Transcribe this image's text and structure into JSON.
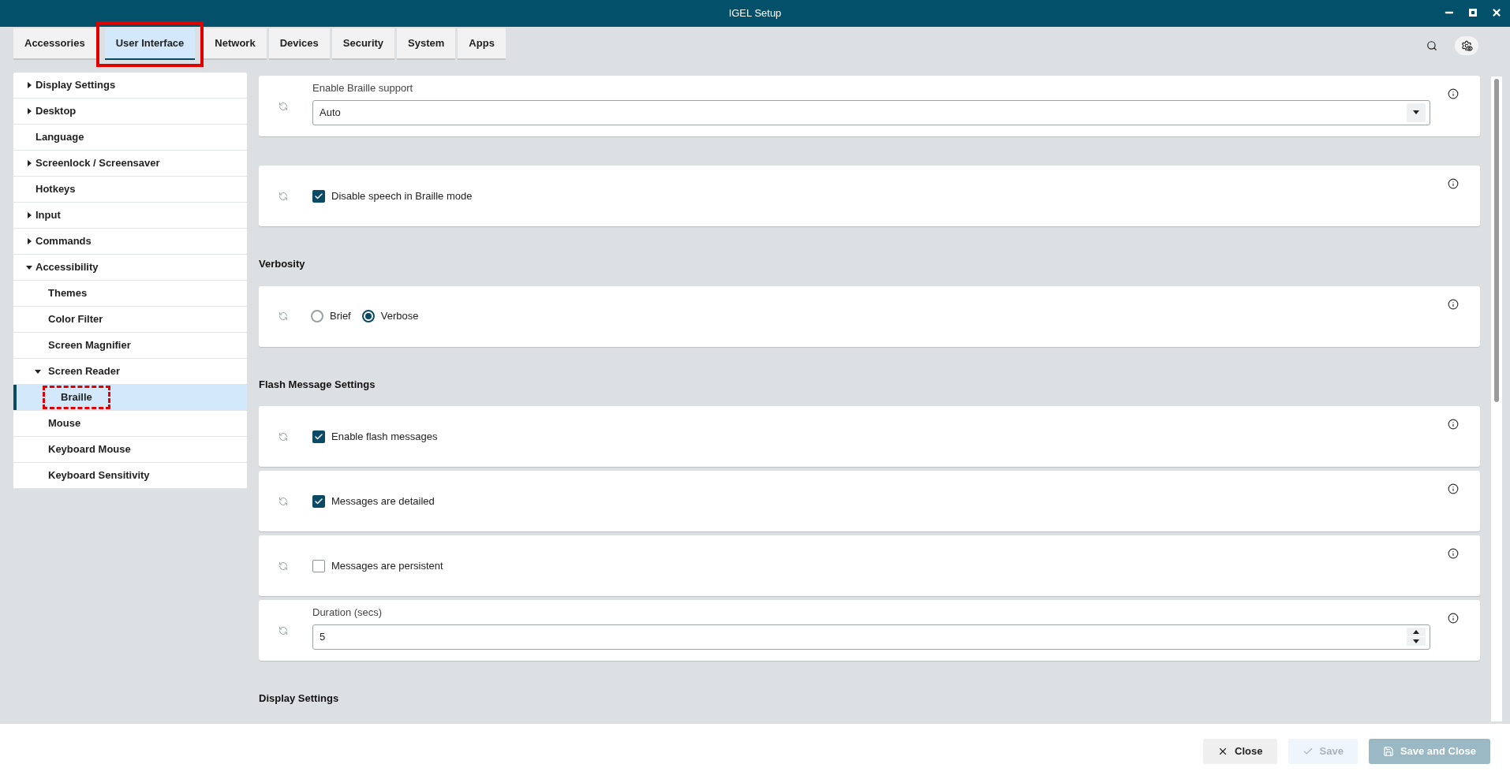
{
  "window": {
    "title": "IGEL Setup"
  },
  "tabs": [
    {
      "label": "Accessories",
      "selected": false,
      "highlighted": false
    },
    {
      "label": "User Interface",
      "selected": true,
      "highlighted": true
    },
    {
      "label": "Network",
      "selected": false,
      "highlighted": false
    },
    {
      "label": "Devices",
      "selected": false,
      "highlighted": false
    },
    {
      "label": "Security",
      "selected": false,
      "highlighted": false
    },
    {
      "label": "System",
      "selected": false,
      "highlighted": false
    },
    {
      "label": "Apps",
      "selected": false,
      "highlighted": false
    }
  ],
  "sidebar": {
    "items": [
      {
        "label": "Display Settings",
        "expanded": false,
        "selected": false
      },
      {
        "label": "Desktop",
        "expanded": false,
        "selected": false
      },
      {
        "label": "Language",
        "selected": false
      },
      {
        "label": "Screenlock / Screensaver",
        "expanded": false,
        "selected": false
      },
      {
        "label": "Hotkeys",
        "selected": false
      },
      {
        "label": "Input",
        "expanded": false,
        "selected": false
      },
      {
        "label": "Commands",
        "expanded": false,
        "selected": false
      },
      {
        "label": "Accessibility",
        "expanded": true,
        "selected": false,
        "children": [
          {
            "label": "Themes",
            "selected": false
          },
          {
            "label": "Color Filter",
            "selected": false
          },
          {
            "label": "Screen Magnifier",
            "selected": false
          },
          {
            "label": "Screen Reader",
            "expanded": true,
            "selected": false,
            "children": [
              {
                "label": "Braille",
                "selected": true,
                "highlighted": true
              }
            ]
          },
          {
            "label": "Mouse",
            "selected": false
          },
          {
            "label": "Keyboard Mouse",
            "selected": false
          },
          {
            "label": "Keyboard Sensitivity",
            "selected": false
          }
        ]
      }
    ]
  },
  "sections": [
    {
      "settings": [
        {
          "kind": "select",
          "label": "Enable Braille support",
          "value": "Auto"
        }
      ]
    },
    {
      "settings": [
        {
          "kind": "checkbox",
          "label": "Disable speech in Braille mode",
          "checked": true
        }
      ]
    },
    {
      "heading": "Verbosity",
      "settings": [
        {
          "kind": "radio",
          "options": [
            {
              "label": "Brief",
              "selected": false
            },
            {
              "label": "Verbose",
              "selected": true
            }
          ]
        }
      ]
    },
    {
      "heading": "Flash Message Settings",
      "settings": [
        {
          "kind": "checkbox",
          "label": "Enable flash messages",
          "checked": true
        },
        {
          "kind": "checkbox",
          "label": "Messages are detailed",
          "checked": true
        },
        {
          "kind": "checkbox",
          "label": "Messages are persistent",
          "checked": false
        },
        {
          "kind": "number",
          "label": "Duration (secs)",
          "value": "5"
        }
      ]
    },
    {
      "heading": "Display Settings"
    }
  ],
  "footer": {
    "buttons": [
      {
        "kind": "close",
        "label": "Close",
        "disabled": false
      },
      {
        "kind": "save",
        "label": "Save",
        "disabled": true
      },
      {
        "kind": "save-close",
        "label": "Save and Close",
        "disabled": true
      }
    ]
  }
}
